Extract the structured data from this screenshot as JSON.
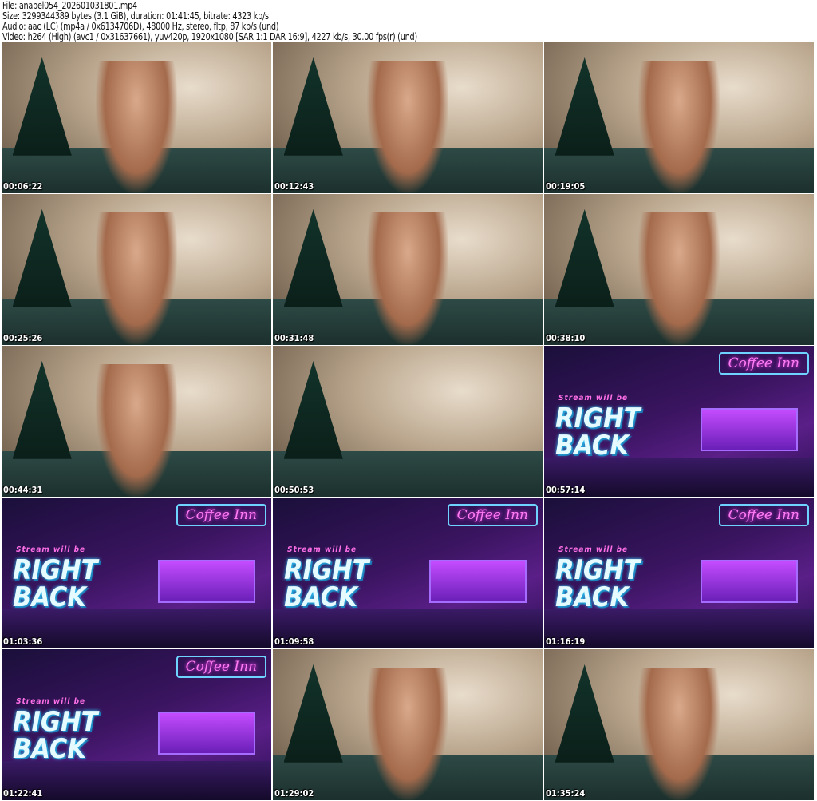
{
  "header": {
    "file": "File: anabel054_202601031801.mp4",
    "size": "Size: 3299344389 bytes (3.1 GiB), duration: 01:41:45, bitrate: 4323 kb/s",
    "audio": "Audio: aac (LC) (mp4a / 0x6134706D), 48000 Hz, stereo, fltp, 87 kb/s (und)",
    "video": "Video: h264 (High) (avc1 / 0x31637661), yuv420p, 1920x1080 [SAR 1:1 DAR 16:9], 4227 kb/s, 30.00 fps(r) (und)"
  },
  "brb_text": {
    "sign": "Coffee Inn",
    "sub": "Stream will be",
    "big1": "RIGHT",
    "big2": "BACK"
  },
  "thumbnails": [
    {
      "time": "00:06:22",
      "scene": "room"
    },
    {
      "time": "00:12:43",
      "scene": "room"
    },
    {
      "time": "00:19:05",
      "scene": "room"
    },
    {
      "time": "00:25:26",
      "scene": "room"
    },
    {
      "time": "00:31:48",
      "scene": "room"
    },
    {
      "time": "00:38:10",
      "scene": "room"
    },
    {
      "time": "00:44:31",
      "scene": "room"
    },
    {
      "time": "00:50:53",
      "scene": "room-empty"
    },
    {
      "time": "00:57:14",
      "scene": "be-right-back"
    },
    {
      "time": "01:03:36",
      "scene": "be-right-back"
    },
    {
      "time": "01:09:58",
      "scene": "be-right-back"
    },
    {
      "time": "01:16:19",
      "scene": "be-right-back"
    },
    {
      "time": "01:22:41",
      "scene": "be-right-back"
    },
    {
      "time": "01:29:02",
      "scene": "room"
    },
    {
      "time": "01:35:24",
      "scene": "room"
    }
  ]
}
